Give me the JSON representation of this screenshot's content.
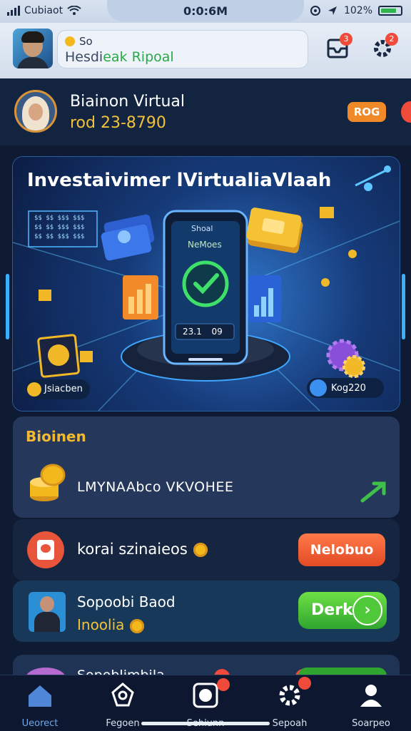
{
  "status_bar": {
    "carrier": "Cubiaot",
    "time": "0:0:6M",
    "battery": "102%"
  },
  "header": {
    "search_line1": "So",
    "search_line2_a": "Hesdi",
    "search_line2_b": "eak Ripoal",
    "notif_badge": "3",
    "settings_badge": "2"
  },
  "profile": {
    "name": "Biainon Virtual",
    "id": "rod 23-8790",
    "pill": "ROG"
  },
  "banner": {
    "title": "Investaivimer lVirtualiaVlaah",
    "phone_top": "Shoal",
    "phone_mid": "NeMoes",
    "phone_code": "23.1",
    "phone_code2": "09",
    "chip_left": "Jsiacben",
    "chip_right": "Kog220",
    "table_rows": [
      "$$ $$ $$$ $$$",
      "$$ $$ $$$ $$$",
      "$$ $$ $$$ $$$"
    ]
  },
  "section": {
    "title": "Bioinen",
    "label": "LMYNAAbco VKVOHEE"
  },
  "rows": [
    {
      "text": "korai szinaieos",
      "button": "Nelobuo"
    },
    {
      "title": "Sopoobi Baod",
      "subtitle": "Inoolia",
      "button": "Derk"
    },
    {
      "title": "Sopoblimbila"
    }
  ],
  "nav": [
    {
      "label": "Ueorect",
      "icon": "home-icon"
    },
    {
      "label": "Fegoen",
      "icon": "gem-icon"
    },
    {
      "label": "Sehiunn",
      "icon": "camera-icon"
    },
    {
      "label": "Sepoah",
      "icon": "gear-icon"
    },
    {
      "label": "Soarpeo",
      "icon": "user-icon"
    }
  ],
  "colors": {
    "accent_orange": "#f08a28",
    "accent_gold": "#f2c13b",
    "accent_green": "#2fa52f",
    "badge_red": "#f04b3a",
    "nav_active": "#6fa6e8"
  }
}
